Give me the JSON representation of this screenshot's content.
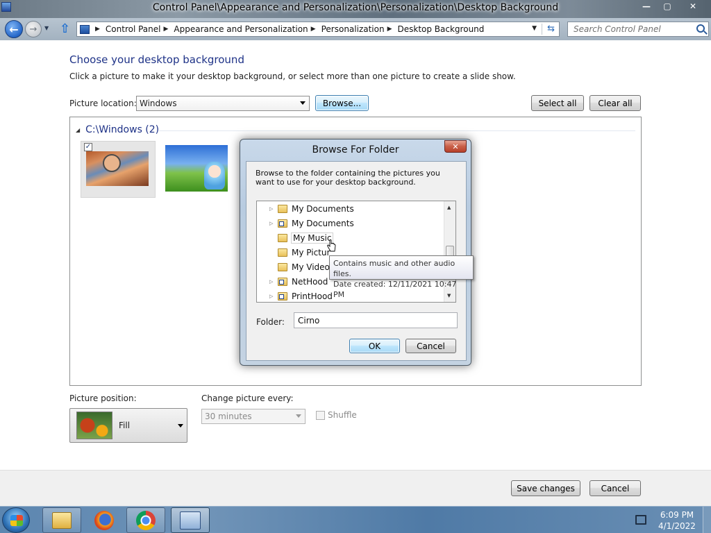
{
  "window": {
    "title": "Control Panel\\Appearance and Personalization\\Personalization\\Desktop Background",
    "minimize_label": "—",
    "maximize_label": "▢",
    "close_label": "✕"
  },
  "address_bar": {
    "breadcrumbs": [
      "Control Panel",
      "Appearance and Personalization",
      "Personalization",
      "Desktop Background"
    ],
    "search_placeholder": "Search Control Panel"
  },
  "main": {
    "heading": "Choose your desktop background",
    "description": "Click a picture to make it your desktop background, or select more than one picture to create a slide show.",
    "picture_location_label": "Picture location:",
    "picture_location_value": "Windows",
    "browse_label": "Browse...",
    "select_all_label": "Select all",
    "clear_all_label": "Clear all",
    "group_label": "C:\\Windows (2)",
    "picture_position_label": "Picture position:",
    "picture_position_value": "Fill",
    "change_every_label": "Change picture every:",
    "change_every_value": "30 minutes",
    "shuffle_label": "Shuffle",
    "save_label": "Save changes",
    "cancel_label": "Cancel"
  },
  "dialog": {
    "title": "Browse For Folder",
    "instructions": "Browse to the folder containing the pictures you want to use for your desktop background.",
    "tree_items": [
      {
        "label": "My Documents",
        "expandable": true,
        "link": false
      },
      {
        "label": "My Documents",
        "expandable": true,
        "link": true
      },
      {
        "label": "My Music",
        "expandable": false,
        "link": false
      },
      {
        "label": "My Pictur",
        "expandable": false,
        "link": false
      },
      {
        "label": "My Videos",
        "expandable": false,
        "link": false
      },
      {
        "label": "NetHood",
        "expandable": true,
        "link": true
      },
      {
        "label": "PrintHood",
        "expandable": true,
        "link": true
      }
    ],
    "folder_label": "Folder:",
    "folder_value": "Cirno",
    "ok_label": "OK",
    "cancel_label": "Cancel"
  },
  "tooltip": {
    "line1": "Contains music and other audio files.",
    "line2": "Date created: 12/11/2021 10:47 PM"
  },
  "taskbar": {
    "time": "6:09 PM",
    "date": "4/1/2022"
  }
}
